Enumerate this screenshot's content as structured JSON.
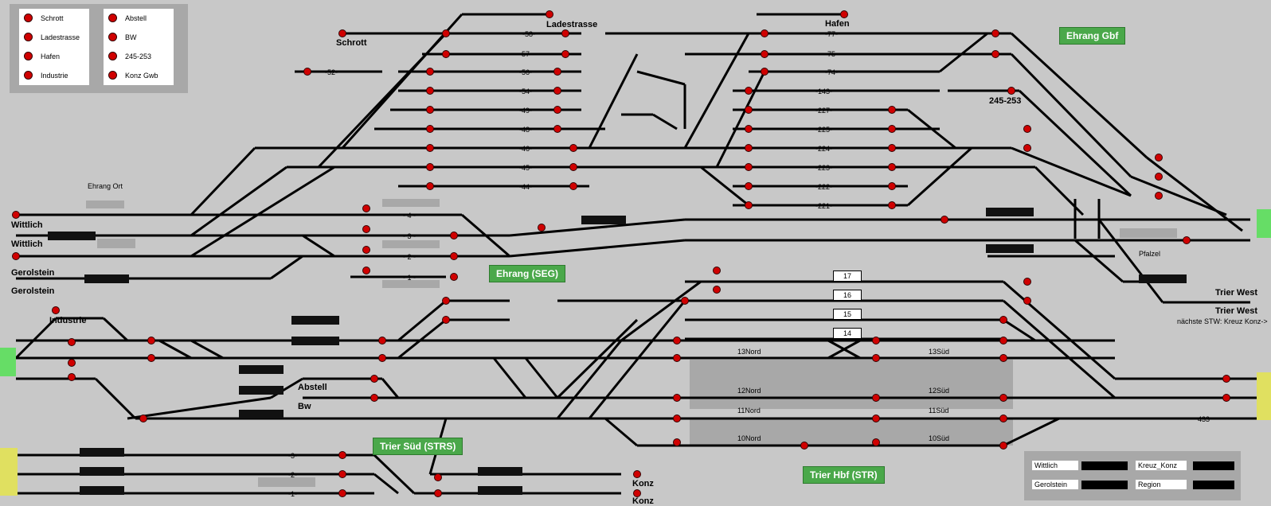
{
  "legend": {
    "left_items": [
      "Schrott",
      "Ladestrasse",
      "Hafen",
      "Industrie"
    ],
    "right_items": [
      "Abstell",
      "BW",
      "245-253",
      "Konz Gwb"
    ]
  },
  "stations": {
    "ehrang_gbf": "Ehrang Gbf",
    "ehrang_seg": "Ehrang (SEG)",
    "trier_sued": "Trier Süd (STRS)",
    "trier_hbf": "Trier Hbf (STR)"
  },
  "labels": {
    "schrott": "Schrott",
    "ladestrasse": "Ladestrasse",
    "hafen": "Hafen",
    "n245": "245-253",
    "ehrang_ort": "Ehrang Ort",
    "wittlich1": "Wittlich",
    "wittlich2": "Wittlich",
    "gerolstein1": "Gerolstein",
    "gerolstein2": "Gerolstein",
    "industrie": "Industrie",
    "abstell": "Abstell",
    "bw": "Bw",
    "pfalzel": "Pfalzel",
    "trier_west1": "Trier West",
    "trier_west2": "Trier West",
    "naechste": "nächste STW: Kreuz Konz->",
    "konz1": "Konz",
    "konz2": "Konz"
  },
  "track_numbers": {
    "t58": "-58-",
    "t57": "-57-",
    "t56": "-56-",
    "t54": "-54-",
    "t49": "-49-",
    "t48": "-48-",
    "t46": "-46-",
    "t45": "-45-",
    "t44": "-44-",
    "t52": "-52-",
    "t77": "-77-",
    "t75": "-75-",
    "t74": "-74-",
    "t143": "-143-",
    "t227": "-227-",
    "t225": "-225-",
    "t224": "-224-",
    "t223": "-223-",
    "t222": "-222-",
    "t221": "-221-",
    "s4": "- 4 -",
    "s3": "- 3 -",
    "s2": "- 2 -",
    "s1": "- 1 -",
    "g17": "17",
    "g16": "16",
    "g15": "15",
    "g14": "14",
    "n13": "13Nord",
    "s13": "13Süd",
    "n12": "12Nord",
    "s12": "12Süd",
    "n11": "11Nord",
    "s11": "11Süd",
    "n10": "10Nord",
    "s10": "10Süd",
    "m3": "-3-",
    "m2": "-2-",
    "m1": "-1-",
    "t433": "433"
  },
  "bottom_legend": {
    "wittlich": "Wittlich",
    "kreuz_konz": "Kreuz_Konz",
    "gerolstein": "Gerolstein",
    "region": "Region"
  },
  "colors": {
    "background": "#c8c8c8",
    "track": "#000000",
    "signal_red": "#d00000",
    "station_green": "#4aa84a",
    "edge_green": "#66dd66",
    "edge_yellow": "#e0e060",
    "platform_gray": "#a8a8a8"
  }
}
